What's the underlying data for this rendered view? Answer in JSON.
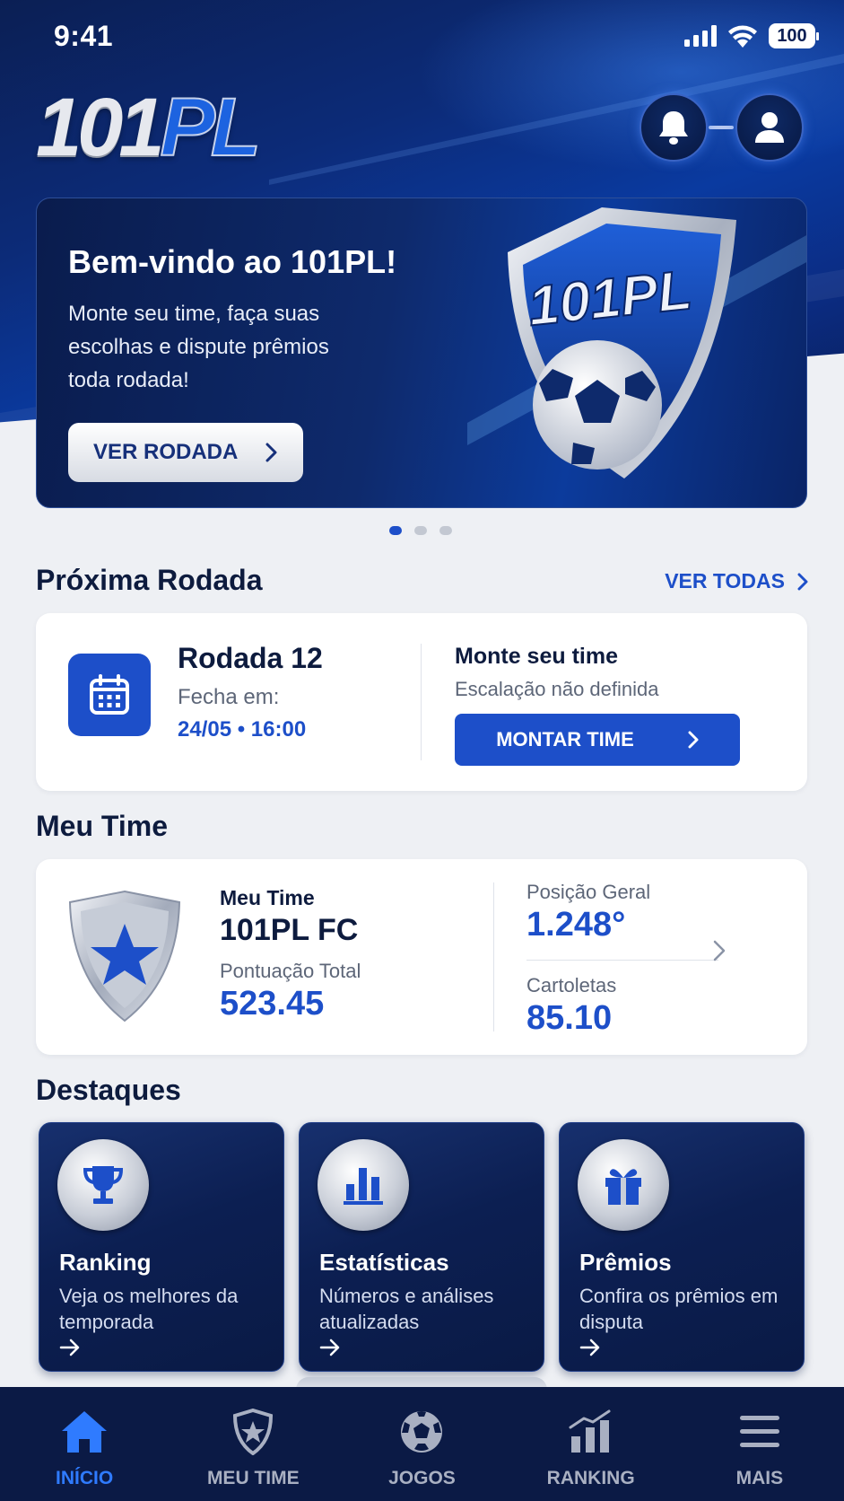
{
  "status_bar": {
    "time": "9:41",
    "battery": "100"
  },
  "header": {
    "logo_part1": "101",
    "logo_part2": "PL"
  },
  "banner": {
    "title": "Bem-vindo ao 101PL!",
    "text": "Monte seu time, faça suas escolhas e dispute prêmios toda rodada!",
    "button_label": "VER RODADA",
    "badge_text": "101PL",
    "carousel_pages": 3,
    "carousel_active": 1
  },
  "next_round": {
    "section_title": "Próxima Rodada",
    "see_all_label": "VER TODAS",
    "round_title": "Rodada 12",
    "closes_label": "Fecha em:",
    "closes_at": "24/05 • 16:00",
    "cta_title": "Monte seu time",
    "cta_subtitle": "Escalação não definida",
    "cta_button": "MONTAR TIME"
  },
  "my_team": {
    "section_title": "Meu Time",
    "label": "Meu Time",
    "team_name": "101PL FC",
    "points_label": "Pontuação Total",
    "points": "523.45",
    "position_label": "Posição Geral",
    "position": "1.248°",
    "coins_label": "Cartoletas",
    "coins": "85.10"
  },
  "highlights": {
    "section_title": "Destaques",
    "items": [
      {
        "title": "Ranking",
        "description": "Veja os melhores da temporada",
        "icon": "trophy-icon"
      },
      {
        "title": "Estatísticas",
        "description": "Números e análises atualizadas",
        "icon": "bar-chart-icon"
      },
      {
        "title": "Prêmios",
        "description": "Confira os prêmios em disputa",
        "icon": "gift-icon"
      }
    ]
  },
  "bottom_nav": {
    "items": [
      {
        "label": "INÍCIO",
        "icon": "home-icon",
        "active": true
      },
      {
        "label": "MEU TIME",
        "icon": "shield-icon",
        "active": false
      },
      {
        "label": "JOGOS",
        "icon": "soccer-ball-icon",
        "active": false
      },
      {
        "label": "RANKING",
        "icon": "ranking-chart-icon",
        "active": false
      },
      {
        "label": "MAIS",
        "icon": "menu-icon",
        "active": false
      }
    ]
  },
  "colors": {
    "primary": "#1d4fc9",
    "navy": "#0b1a45",
    "nav_active": "#2f7bff",
    "background": "#eef0f4"
  }
}
